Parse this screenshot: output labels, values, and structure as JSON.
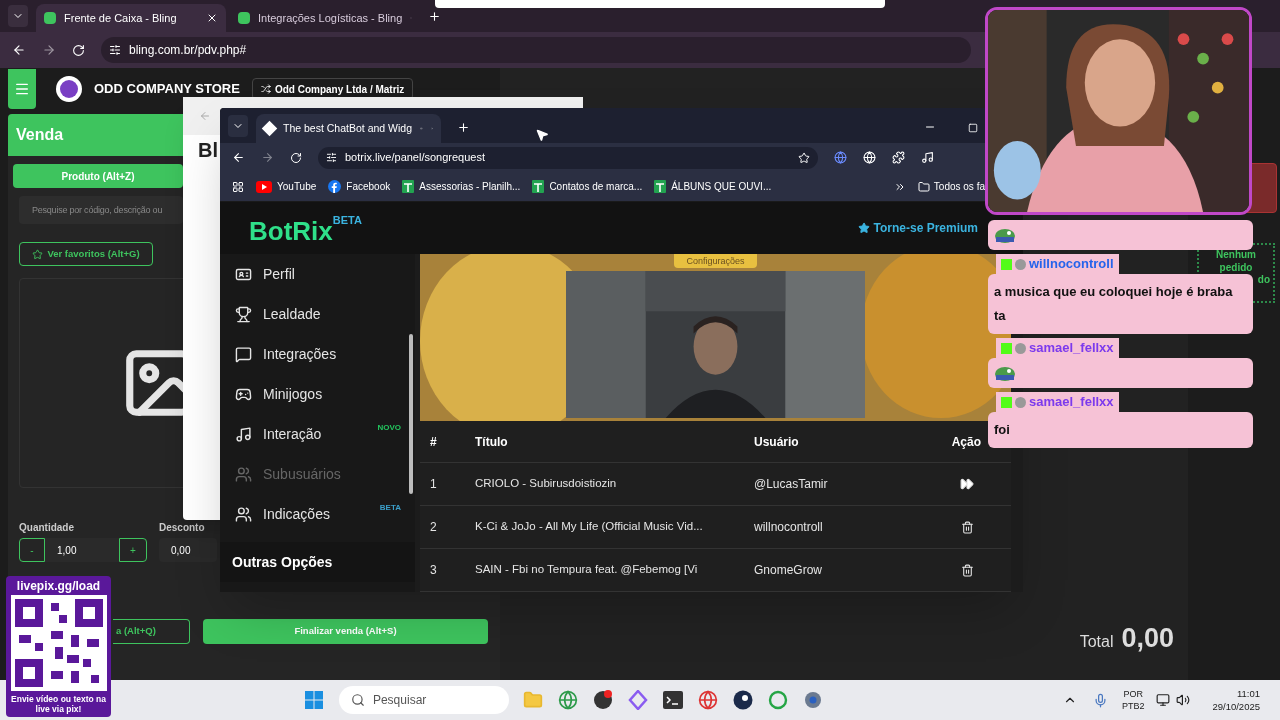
{
  "back_browser": {
    "tabs": [
      {
        "title": "Frente de Caixa - Bling",
        "selected": true
      },
      {
        "title": "Integrações Logísticas - Bling",
        "selected": false
      }
    ],
    "url": "bling.com.br/pdv.php#"
  },
  "bling": {
    "store_name": "ODD COMPANY STORE",
    "company_button": "Odd Company Ltda / Matriz",
    "panel_title": "Venda",
    "product_button": "Produto (Alt+Z)",
    "search": {
      "placeholder": "Pesquise por código, descrição ou"
    },
    "favorites_button": "Ver favoritos (Alt+G)",
    "quantity": {
      "label": "Quantidade",
      "minus": "-",
      "value": "1,00",
      "plus": "+"
    },
    "discount": {
      "label": "Desconto",
      "value": "0,00"
    },
    "cancel_button": "a (Alt+Q)",
    "finish_button": "Finalizar venda (Alt+S)",
    "total_label": "Total",
    "total_value": "0,00",
    "orders_empty": "Nenhum pedido",
    "orders_empty_cut": "do"
  },
  "middle_window": {
    "title": "Bl"
  },
  "front_browser": {
    "tabs": [
      {
        "title": "The best ChatBot and Widg",
        "selected": true
      }
    ],
    "url": "botrix.live/panel/songrequest",
    "bookmarks": [
      {
        "label": "YouTube",
        "kind": "youtube"
      },
      {
        "label": "Facebook",
        "kind": "facebook"
      },
      {
        "label": "Assessorias - Planilh...",
        "kind": "sheet"
      },
      {
        "label": "Contatos de marca...",
        "kind": "sheet"
      },
      {
        "label": "ÁLBUNS QUE OUVI...",
        "kind": "sheet"
      }
    ],
    "all_bookmarks": "Todos os fa"
  },
  "botrix": {
    "logo": "BotRix",
    "logo_badge": "BETA",
    "premium_link": "Torne-se Premium",
    "menu": [
      {
        "label": "Perfil",
        "kind": "id",
        "disabled": false
      },
      {
        "label": "Lealdade",
        "kind": "trophy",
        "disabled": false
      },
      {
        "label": "Integrações",
        "kind": "chat",
        "disabled": false
      },
      {
        "label": "Minijogos",
        "kind": "gamepad",
        "disabled": false
      },
      {
        "label": "Interação",
        "kind": "music",
        "disabled": false,
        "badge": {
          "text": "NOVO",
          "color": "#22c55e"
        }
      },
      {
        "label": "Subusuários",
        "kind": "users",
        "disabled": true
      },
      {
        "label": "Indicações",
        "kind": "users",
        "disabled": false,
        "badge": {
          "text": "BETA",
          "color": "#3b9ec9"
        }
      }
    ],
    "section": "Outras Opções",
    "config_button": "Configurações",
    "table": {
      "columns": [
        "#",
        "Título",
        "Usuário",
        "Ação"
      ],
      "rows": [
        {
          "number": "1",
          "title": "CRIOLO - Subirusdoistiozin",
          "user": "@LucasTamir",
          "kind": "skip"
        },
        {
          "number": "2",
          "title": "K-Ci & JoJo - All My Life (Official Music Vid...",
          "user": "willnocontroll",
          "kind": "delete"
        },
        {
          "number": "3",
          "title": "SAIN - Fbi no Tempura feat. @Febemog [Vi",
          "user": "GnomeGrow",
          "kind": "delete"
        }
      ]
    }
  },
  "chat": {
    "messages": [
      {
        "kind": "emote"
      },
      {
        "kind": "text",
        "user": "willnocontroll",
        "color": "#2563eb",
        "text": "a musica que eu coloquei hoje é braba ta"
      },
      {
        "kind": "emote",
        "user": "samael_fellxx",
        "color": "#7c3aed"
      },
      {
        "kind": "text",
        "user": "samael_fellxx",
        "color": "#7c3aed",
        "text": "foi"
      }
    ]
  },
  "qr_overlay": {
    "title": "livepix.gg/load",
    "caption": "Envie vídeo ou texto na live via pix!"
  },
  "taskbar": {
    "search": {
      "placeholder": "Pesquisar"
    },
    "language": "POR",
    "layout": "PTB2",
    "time": "11:01",
    "date": "29/10/2025"
  }
}
